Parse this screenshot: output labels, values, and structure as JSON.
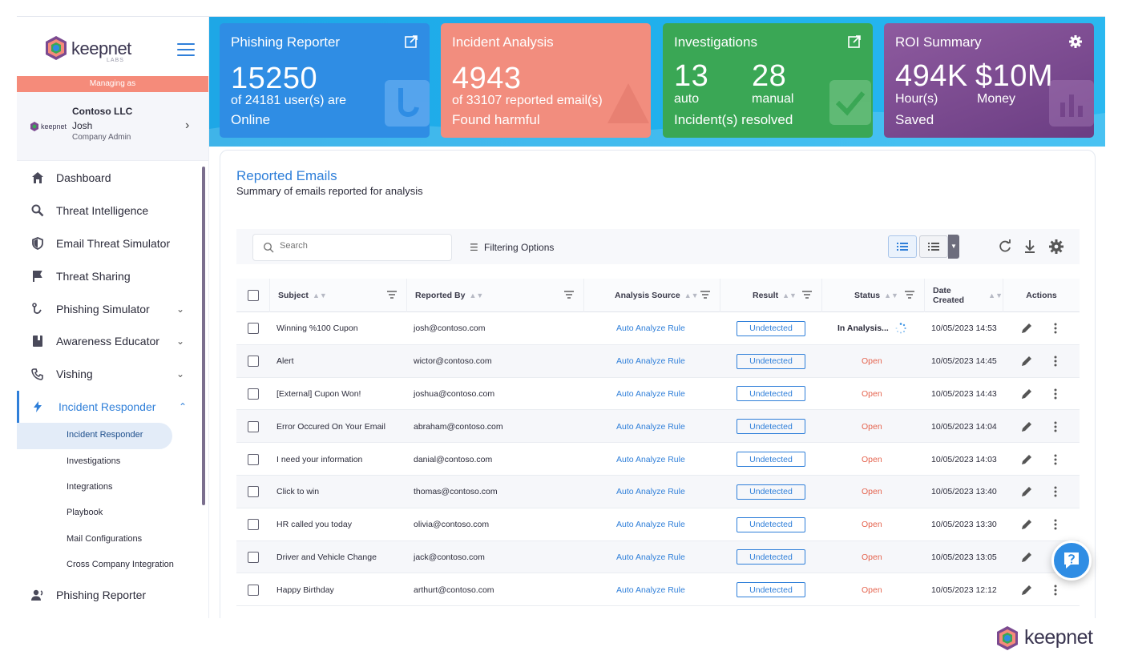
{
  "brand": {
    "logo_text": "keepnet",
    "logo_sub": "LABS",
    "footer_logo_text": "keepnet",
    "colors": {
      "blue": "#2f8de4",
      "salmon": "#f28d7e",
      "green": "#3aa755",
      "purple": "#7b4a90",
      "link": "#2f7fd9",
      "open": "#e5644f"
    }
  },
  "sidebar": {
    "managing_as": "Managing as",
    "company": {
      "mini_logo": "keepnet",
      "name": "Contoso LLC",
      "user": "Josh",
      "role": "Company Admin"
    },
    "items": [
      {
        "label": "Dashboard",
        "icon": "home-icon"
      },
      {
        "label": "Threat Intelligence",
        "icon": "magnifier-icon"
      },
      {
        "label": "Email Threat Simulator",
        "icon": "shield-icon"
      },
      {
        "label": "Threat Sharing",
        "icon": "flag-icon"
      },
      {
        "label": "Phishing Simulator",
        "icon": "hook-icon"
      },
      {
        "label": "Awareness Educator",
        "icon": "book-icon"
      },
      {
        "label": "Vishing",
        "icon": "phone-icon"
      },
      {
        "label": "Incident Responder",
        "icon": "bolt-icon"
      },
      {
        "label": "Phishing Reporter",
        "icon": "users-icon"
      }
    ],
    "subitems": [
      {
        "label": "Incident Responder"
      },
      {
        "label": "Investigations"
      },
      {
        "label": "Integrations"
      },
      {
        "label": "Playbook"
      },
      {
        "label": "Mail Configurations"
      },
      {
        "label": "Cross Company Integration"
      }
    ]
  },
  "cards": {
    "phishing_reporter": {
      "title": "Phishing Reporter",
      "value": "15250",
      "line1": "of 24181 user(s) are",
      "line2": "Online"
    },
    "incident_analysis": {
      "title": "Incident Analysis",
      "value": "4943",
      "line1": "of 33107 reported email(s)",
      "line2": "Found harmful"
    },
    "investigations": {
      "title": "Investigations",
      "auto_value": "13",
      "manual_value": "28",
      "auto_label": "auto",
      "manual_label": "manual",
      "line2": "Incident(s) resolved"
    },
    "roi": {
      "title": "ROI Summary",
      "hours_value": "494K",
      "money_value": "$10M",
      "hours_label": "Hour(s)",
      "money_label": "Money",
      "line2": "Saved"
    }
  },
  "panel": {
    "title": "Reported Emails",
    "subtitle": "Summary of emails reported for analysis",
    "search_placeholder": "Search",
    "filter_label": "Filtering Options",
    "columns": [
      "Subject",
      "Reported By",
      "Analysis Source",
      "Result",
      "Status",
      "Date Created",
      "Actions"
    ],
    "rows": [
      {
        "subject": "Winning %100 Cupon",
        "reported_by": "josh@contoso.com",
        "source": "Auto Analyze Rule",
        "result": "Undetected",
        "status": "In Analysis...",
        "date": "10/05/2023 14:53"
      },
      {
        "subject": "Alert",
        "reported_by": "wictor@contoso.com",
        "source": "Auto Analyze Rule",
        "result": "Undetected",
        "status": "Open",
        "date": "10/05/2023 14:45"
      },
      {
        "subject": "[External] Cupon Won!",
        "reported_by": "joshua@contoso.com",
        "source": "Auto Analyze Rule",
        "result": "Undetected",
        "status": "Open",
        "date": "10/05/2023 14:43"
      },
      {
        "subject": "Error Occured On Your Email",
        "reported_by": "abraham@contoso.com",
        "source": "Auto Analyze Rule",
        "result": "Undetected",
        "status": "Open",
        "date": "10/05/2023 14:04"
      },
      {
        "subject": "I need your information",
        "reported_by": "danial@contoso.com",
        "source": "Auto Analyze Rule",
        "result": "Undetected",
        "status": "Open",
        "date": "10/05/2023 14:03"
      },
      {
        "subject": "Click to win",
        "reported_by": "thomas@contoso.com",
        "source": "Auto Analyze Rule",
        "result": "Undetected",
        "status": "Open",
        "date": "10/05/2023 13:40"
      },
      {
        "subject": "HR called you today",
        "reported_by": "olivia@contoso.com",
        "source": "Auto Analyze Rule",
        "result": "Undetected",
        "status": "Open",
        "date": "10/05/2023 13:30"
      },
      {
        "subject": "Driver and Vehicle Change",
        "reported_by": "jack@contoso.com",
        "source": "Auto Analyze Rule",
        "result": "Undetected",
        "status": "Open",
        "date": "10/05/2023 13:05"
      },
      {
        "subject": "Happy Birthday",
        "reported_by": "arthurt@contoso.com",
        "source": "Auto Analyze Rule",
        "result": "Undetected",
        "status": "Open",
        "date": "10/05/2023 12:12"
      }
    ]
  }
}
